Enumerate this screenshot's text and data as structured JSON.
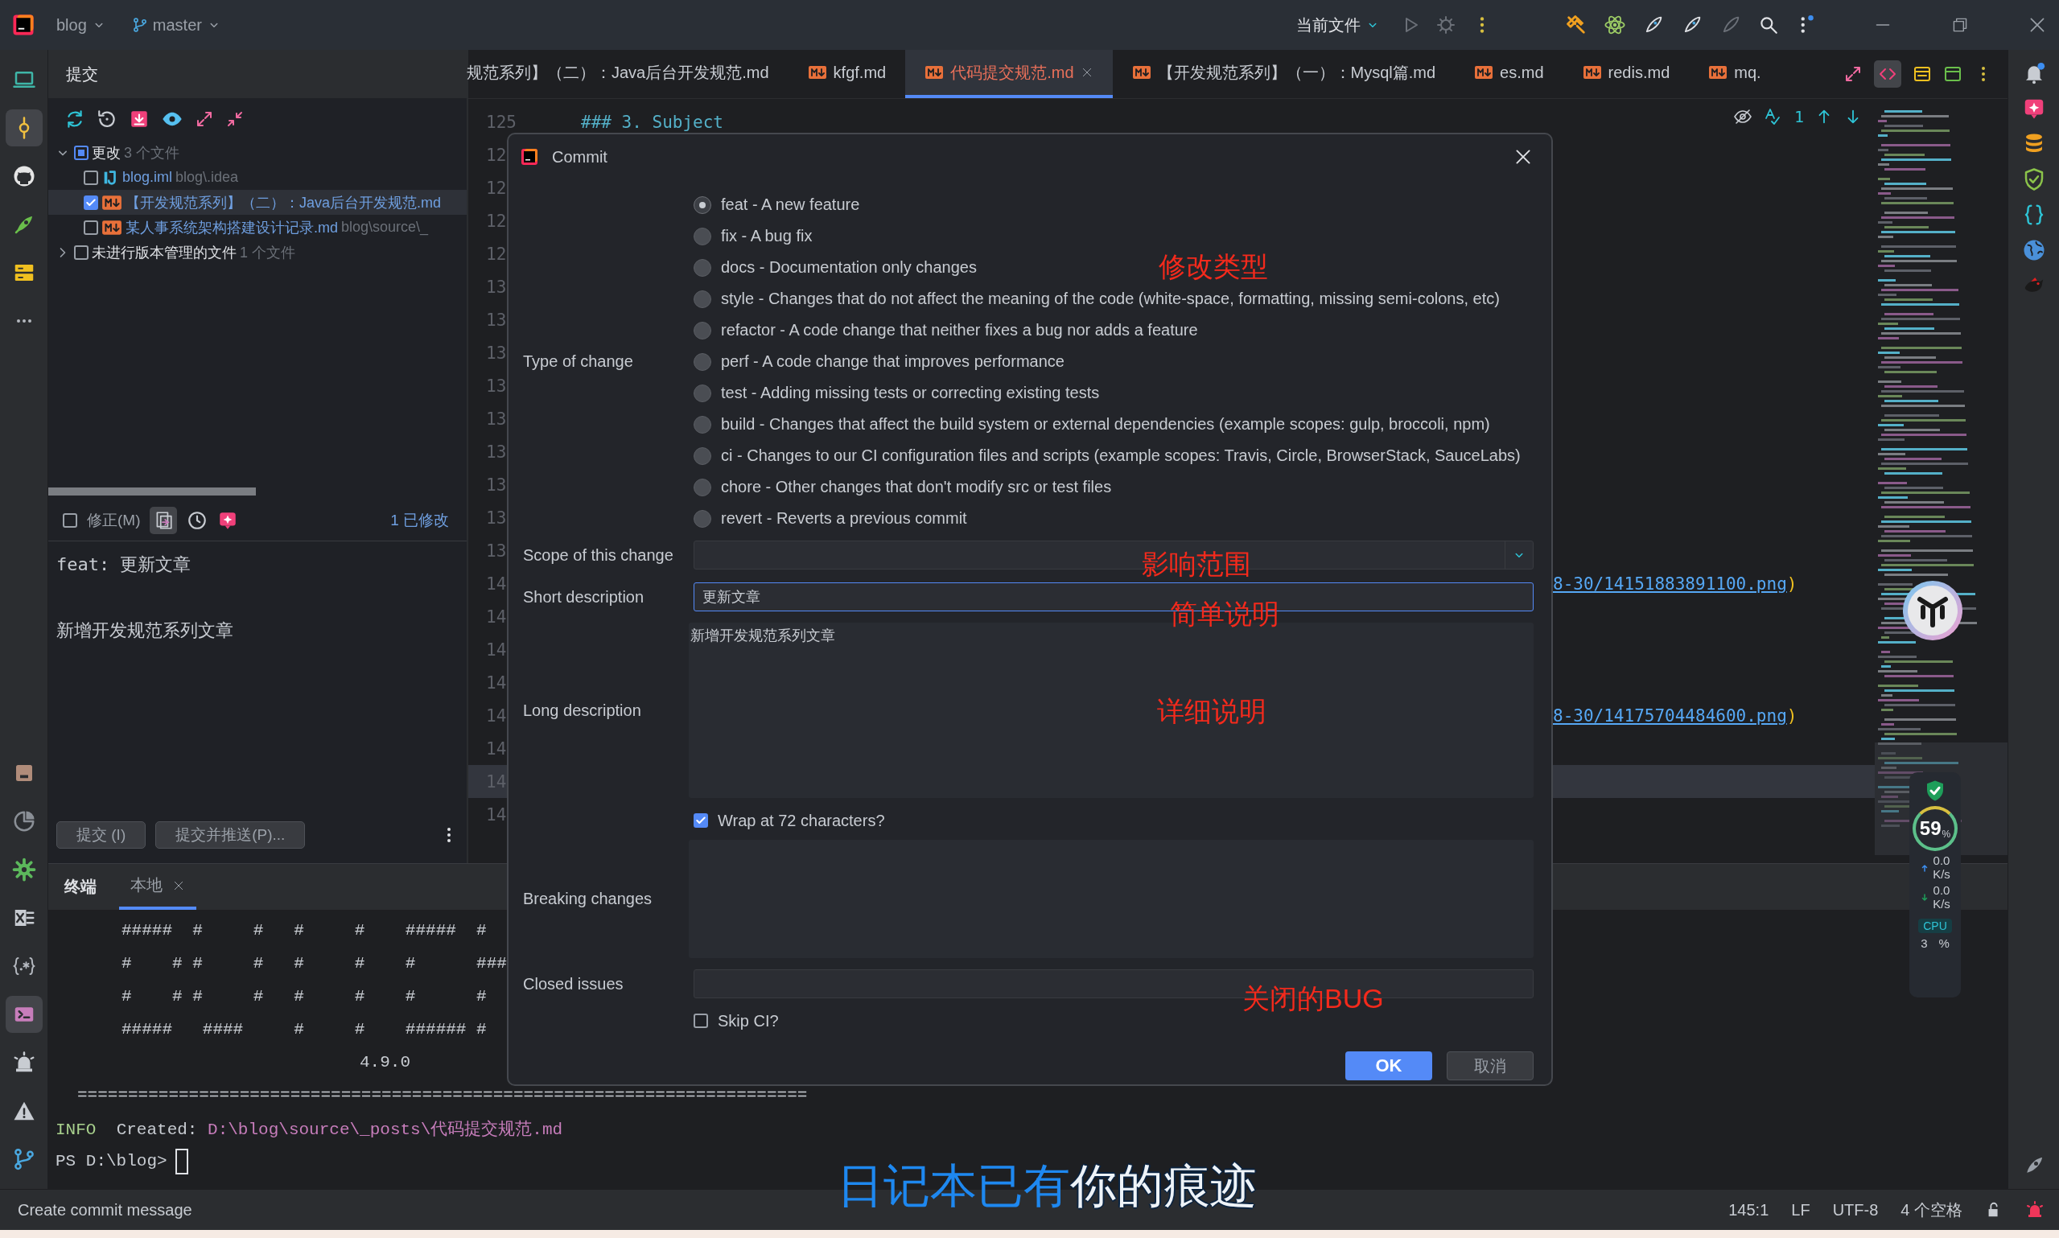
{
  "titlebar": {
    "project": "blog",
    "branch": "master",
    "run_config": "当前文件"
  },
  "tool_strip_top": [
    {
      "selected": false
    },
    {
      "selected": true
    },
    {
      "selected": false
    },
    {
      "selected": false
    },
    {
      "selected": false
    },
    {
      "selected": false
    }
  ],
  "tool_strip_bottom": [
    {
      "selected": false
    },
    {
      "selected": false
    },
    {
      "selected": false
    },
    {
      "selected": false
    },
    {
      "selected": false
    },
    {
      "selected": true
    },
    {
      "selected": false
    },
    {
      "selected": false
    },
    {
      "selected": false
    }
  ],
  "commit_panel": {
    "title": "提交",
    "tree": [
      {
        "label": "更改",
        "note": "3 个文件",
        "expanded": true,
        "checked": true,
        "partial": true,
        "children": [
          {
            "label": "blog.iml",
            "note": "blog\\.idea",
            "kind": "module",
            "checked": false,
            "selected": false
          },
          {
            "label": "【开发规范系列】（二）：Java后台开发规范.md",
            "kind": "md",
            "checked": true,
            "selected": true
          },
          {
            "label": "某人事系统架构搭建设计记录.md",
            "note": "blog\\source\\_",
            "kind": "md",
            "checked": false,
            "selected": false
          }
        ]
      },
      {
        "label": "未进行版本管理的文件",
        "note": "1 个文件",
        "expanded": false,
        "checked": false
      }
    ],
    "amend": {
      "label": "修正(M)",
      "checked": false
    },
    "modified_count": "1 已修改",
    "message": {
      "subject": "feat: 更新文章",
      "body": "新增开发规范系列文章"
    },
    "buttons": [
      "提交 (I)",
      "提交并推送(P)..."
    ]
  },
  "editor": {
    "tabs": [
      {
        "label": "规范系列】（二）：Java后台开发规范.md",
        "kind": "cut",
        "selected": false
      },
      {
        "label": "kfgf.md",
        "kind": "md",
        "selected": false
      },
      {
        "label": "代码提交规范.md",
        "kind": "md",
        "selected": true
      },
      {
        "label": "【开发规范系列】（一）：Mysql篇.md",
        "kind": "md",
        "selected": false
      },
      {
        "label": "es.md",
        "kind": "md",
        "selected": false
      },
      {
        "label": "redis.md",
        "kind": "md",
        "selected": false
      },
      {
        "label": "mq.",
        "kind": "md",
        "selected": false
      }
    ],
    "inspection_count": "1",
    "lines": [
      {
        "number": "125",
        "kind": "heading",
        "text": "### 3. Subject",
        "current": false
      },
      {
        "number": "12",
        "current": false
      },
      {
        "number": "12",
        "current": false
      },
      {
        "number": "12",
        "current": false
      },
      {
        "number": "12",
        "current": false
      },
      {
        "number": "13",
        "current": false
      },
      {
        "number": "13",
        "current": false
      },
      {
        "number": "13",
        "current": false
      },
      {
        "number": "13",
        "current": false
      },
      {
        "number": "13",
        "current": false
      },
      {
        "number": "13",
        "current": false
      },
      {
        "number": "13",
        "current": false
      },
      {
        "number": "13",
        "current": false
      },
      {
        "number": "13",
        "current": false
      },
      {
        "number": "14",
        "kind": "link",
        "text": "8-30/14151883891100.png",
        "suffix": ")",
        "current": false
      },
      {
        "number": "14",
        "current": false
      },
      {
        "number": "14",
        "current": false
      },
      {
        "number": "14",
        "current": false
      },
      {
        "number": "14",
        "kind": "link",
        "text": "8-30/14175704484600.png",
        "suffix": ")",
        "current": false
      },
      {
        "number": "14",
        "current": false
      },
      {
        "number": "14",
        "current": true
      },
      {
        "number": "14",
        "current": false
      }
    ]
  },
  "terminal": {
    "title": "终端",
    "tabs": [
      {
        "label": "本地",
        "selected": true
      }
    ],
    "lines": [
      {
        "kind": "art",
        "text": "#####  #     #   #     #    #####  #"
      },
      {
        "kind": "art",
        "text": "#    # #     #   #     #    #      ###"
      },
      {
        "kind": "art",
        "text": "#    # #     #   #     #    #      #"
      },
      {
        "kind": "art",
        "text": "#####   ####     #     #    ###### #"
      },
      {
        "kind": "version",
        "text": "4.9.0"
      },
      {
        "kind": "rule",
        "text": "========================================================================"
      },
      {
        "kind": "info",
        "level_tag": "INFO",
        "text": "Created: ",
        "path": "D:\\blog\\source\\_posts\\代码提交规范.md"
      },
      {
        "kind": "prompt",
        "text": "PS D:\\blog>"
      }
    ]
  },
  "status_bar": {
    "message": "Create commit message",
    "position": "145:1",
    "line_separator": "LF",
    "encoding": "UTF-8",
    "indent": "4 个空格"
  },
  "commit_dialog": {
    "title": "Commit",
    "type_label": "Type of change",
    "types": [
      {
        "label": "feat - A new feature",
        "selected": true
      },
      {
        "label": "fix - A bug fix",
        "selected": false
      },
      {
        "label": "docs - Documentation only changes",
        "selected": false
      },
      {
        "label": "style - Changes that do not affect the meaning of the code (white-space, formatting, missing semi-colons, etc)",
        "selected": false
      },
      {
        "label": "refactor - A code change that neither fixes a bug nor adds a feature",
        "selected": false
      },
      {
        "label": "perf - A code change that improves performance",
        "selected": false
      },
      {
        "label": "test - Adding missing tests or correcting existing tests",
        "selected": false
      },
      {
        "label": "build - Changes that affect the build system or external dependencies (example scopes: gulp, broccoli, npm)",
        "selected": false
      },
      {
        "label": "ci - Changes to our CI configuration files and scripts (example scopes: Travis, Circle, BrowserStack, SauceLabs)",
        "selected": false
      },
      {
        "label": "chore - Other changes that don't modify src or test files",
        "selected": false
      },
      {
        "label": "revert - Reverts a previous commit",
        "selected": false
      }
    ],
    "scope_label": "Scope of this change",
    "short_label": "Short description",
    "short_value": "更新文章",
    "long_label": "Long description",
    "long_value": "新增开发规范系列文章",
    "wrap": {
      "label": "Wrap at 72 characters?",
      "checked": true
    },
    "breaking_label": "Breaking changes",
    "closed_label": "Closed issues",
    "skip_ci": {
      "label": "Skip CI?",
      "checked": false
    },
    "ok": "OK",
    "cancel": "取消",
    "annotations": [
      "修改类型",
      "影响范围",
      "简单说明",
      "详细说明",
      "关闭的BUG"
    ]
  },
  "monitor_widget": {
    "percent": "59",
    "percent_unit": "%",
    "up": "0.0",
    "up_unit": "K/s",
    "down": "0.0",
    "down_unit": "K/s",
    "cpu_label": "CPU",
    "cpu": "3",
    "cpu_unit": "%"
  },
  "lyrics": {
    "sung": "日记本已有",
    "unsung": "你的痕迹"
  }
}
